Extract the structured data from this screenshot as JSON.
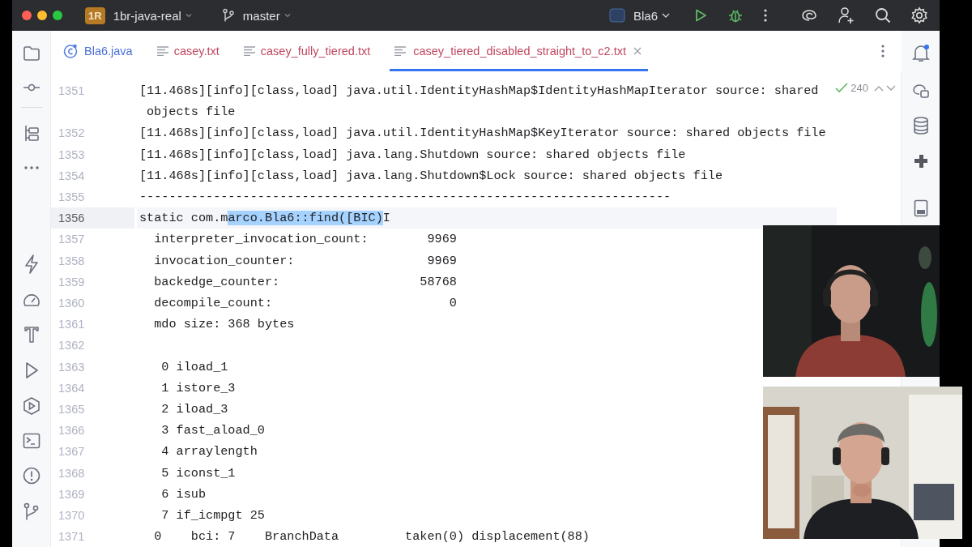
{
  "title_bar": {
    "project_badge": "1R",
    "project": "1br-java-real",
    "branch": "master",
    "run_config": "Bla6"
  },
  "tabs": [
    {
      "label": "Bla6.java",
      "kind": "class",
      "color": "#4a6fd8",
      "selected": false
    },
    {
      "label": "casey.txt",
      "kind": "text",
      "color": "#c0475e",
      "selected": false
    },
    {
      "label": "casey_fully_tiered.txt",
      "kind": "text",
      "color": "#c0475e",
      "selected": false
    },
    {
      "label": "casey_tiered_disabled_straight_to_c2.txt",
      "kind": "text",
      "color": "#c0475e",
      "selected": true
    }
  ],
  "editor": {
    "match_count": "240",
    "lines": [
      {
        "number": "1351",
        "text": "[11.468s][info][class,load] java.util.IdentityHashMap$IdentityHashMapIterator source: shared objects file",
        "current": false
      },
      {
        "number": "1352",
        "text": "[11.468s][info][class,load] java.util.IdentityHashMap$KeyIterator source: shared objects file",
        "current": false
      },
      {
        "number": "1353",
        "text": "[11.468s][info][class,load] java.lang.Shutdown source: shared objects file",
        "current": false
      },
      {
        "number": "1354",
        "text": "[11.468s][info][class,load] java.lang.Shutdown$Lock source: shared objects file",
        "current": false
      },
      {
        "number": "1355",
        "text": "------------------------------------------------------------------------",
        "current": false
      },
      {
        "number": "1356",
        "text": "static com.m",
        "selection": "arco.Bla6::find([BIC)",
        "after": "I",
        "current": true
      },
      {
        "number": "1357",
        "text": "  interpreter_invocation_count:        9969",
        "current": false
      },
      {
        "number": "1358",
        "text": "  invocation_counter:                  9969",
        "current": false
      },
      {
        "number": "1359",
        "text": "  backedge_counter:                   58768",
        "current": false
      },
      {
        "number": "1360",
        "text": "  decompile_count:                        0",
        "current": false
      },
      {
        "number": "1361",
        "text": "  mdo size: 368 bytes",
        "current": false
      },
      {
        "number": "1362",
        "current": false
      },
      {
        "number": "1363",
        "text": "   0 iload_1",
        "current": false
      },
      {
        "number": "1364",
        "text": "   1 istore_3",
        "current": false
      },
      {
        "number": "1365",
        "text": "   2 iload_3",
        "current": false
      },
      {
        "number": "1366",
        "text": "   3 fast_aload_0",
        "current": false
      },
      {
        "number": "1367",
        "text": "   4 arraylength",
        "current": false
      },
      {
        "number": "1368",
        "text": "   5 iconst_1",
        "current": false
      },
      {
        "number": "1369",
        "text": "   6 isub",
        "current": false
      },
      {
        "number": "1370",
        "text": "   7 if_icmpgt 25",
        "current": false
      },
      {
        "number": "1371",
        "text": "  0    bci: 7    BranchData         taken(0) displacement(88)",
        "current": false
      }
    ]
  }
}
